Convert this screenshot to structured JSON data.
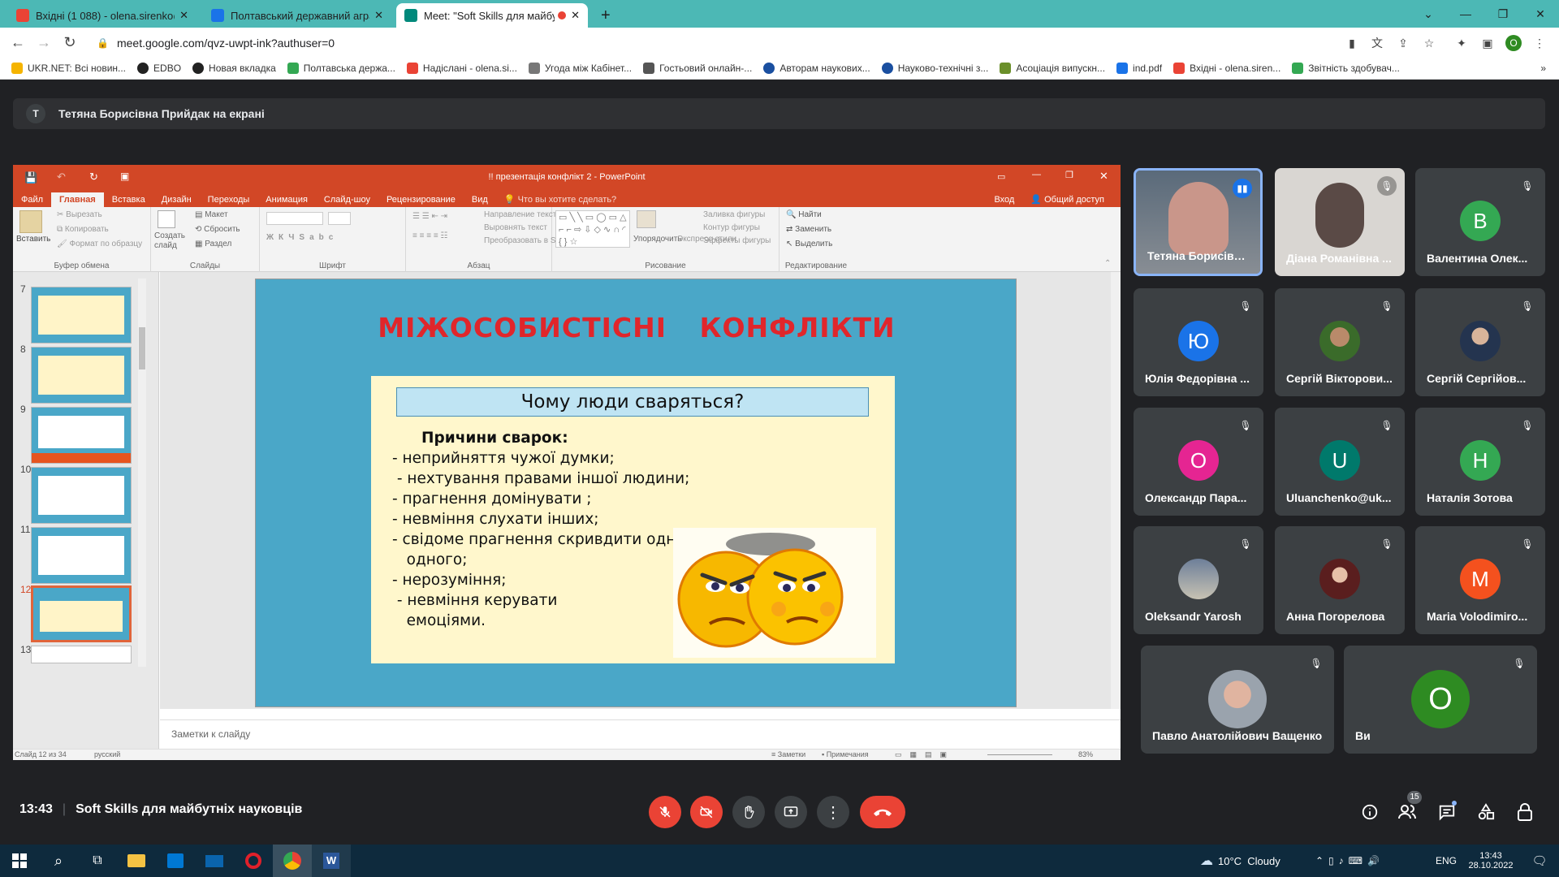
{
  "browser": {
    "tabs": [
      {
        "title": "Вхідні (1 088) - olena.sirenko@p",
        "color": "#ea4335"
      },
      {
        "title": "Полтавський державний аграр",
        "color": "#1a73e8"
      },
      {
        "title": "Meet: \"Soft Skills для майбут",
        "color": "#00897b"
      }
    ],
    "url": "meet.google.com/qvz-uwpt-ink?authuser=0",
    "profile_initial": "O",
    "bookmarks": [
      {
        "label": "UKR.NET: Всі новин...",
        "color": "#f5b400"
      },
      {
        "label": "EDBO",
        "color": "#222222"
      },
      {
        "label": "Новая вкладка",
        "color": "#222222"
      },
      {
        "label": "Полтавська держа...",
        "color": "#34a853"
      },
      {
        "label": "Надіслані - olena.si...",
        "color": "#ea4335"
      },
      {
        "label": "Угода між Кабінет...",
        "color": "#777777"
      },
      {
        "label": "Гостьовий онлайн-...",
        "color": "#555555"
      },
      {
        "label": "Авторам наукових...",
        "color": "#1a4fa0"
      },
      {
        "label": "Науково-технічні з...",
        "color": "#1a4fa0"
      },
      {
        "label": "Асоціація випускн...",
        "color": "#6a8f2a"
      },
      {
        "label": "ind.pdf",
        "color": "#1a73e8"
      },
      {
        "label": "Вхідні - olena.siren...",
        "color": "#ea4335"
      },
      {
        "label": "Звітність здобувач...",
        "color": "#34a853"
      }
    ]
  },
  "meet": {
    "presenter_initial": "Т",
    "presenter_banner": "Тетяна Борисівна Прийдак на екрані",
    "time": "13:43",
    "meeting_title": "Soft Skills для майбутніх науковців",
    "participants_count": "15",
    "participants": [
      {
        "name": "Тетяна Борисівна...",
        "type": "photo",
        "speaking": true
      },
      {
        "name": "Діана Романівна ...",
        "type": "photo"
      },
      {
        "name": "Валентина Олек...",
        "initial": "В",
        "color": "#34a853"
      },
      {
        "name": "Юлія Федорівна ...",
        "initial": "Ю",
        "color": "#1a73e8"
      },
      {
        "name": "Сергій Вікторови...",
        "type": "avatar"
      },
      {
        "name": "Сергій Сергійов...",
        "type": "avatar"
      },
      {
        "name": "Олександр Пара...",
        "initial": "О",
        "color": "#e52592"
      },
      {
        "name": "Uluanchenko@uk...",
        "initial": "U",
        "color": "#00796b"
      },
      {
        "name": "Наталія Зотова",
        "initial": "Н",
        "color": "#34a853"
      },
      {
        "name": "Oleksandr Yarosh",
        "type": "avatar"
      },
      {
        "name": "Анна Погорелова",
        "type": "avatar"
      },
      {
        "name": "Maria Volodimiro...",
        "initial": "M",
        "color": "#f4511e"
      },
      {
        "name": "Павло Анатолійович Ващенко",
        "type": "avatar"
      },
      {
        "name": "Ви",
        "initial": "O",
        "color": "#2e8b22"
      }
    ]
  },
  "ppt": {
    "window_title": "!! презентація конфлікт 2 - PowerPoint",
    "tabs": [
      "Файл",
      "Главная",
      "Вставка",
      "Дизайн",
      "Переходы",
      "Анимация",
      "Слайд-шоу",
      "Рецензирование",
      "Вид"
    ],
    "tell_me": "Что вы хотите сделать?",
    "signin": "Вход",
    "share": "Общий доступ",
    "ribbon": {
      "paste": "Вставить",
      "cut": "Вырезать",
      "copy": "Копировать",
      "format_painter": "Формат по образцу",
      "clipboard_label": "Буфер обмена",
      "new_slide": "Создать слайд",
      "layout": "Макет",
      "reset": "Сбросить",
      "section": "Раздел",
      "slides_label": "Слайды",
      "font_label": "Шрифт",
      "text_direction": "Направление текста",
      "align_text": "Выровнять текст",
      "smartart": "Преобразовать в SmartArt",
      "paragraph_label": "Абзац",
      "arrange": "Упорядочить",
      "quick_styles": "Экспресс-стили",
      "shape_fill": "Заливка фигуры",
      "shape_outline": "Контур фигуры",
      "shape_effects": "Эффекты фигуры",
      "drawing_label": "Рисование",
      "find": "Найти",
      "replace": "Заменить",
      "select": "Выделить",
      "editing_label": "Редактирование"
    },
    "thumb_numbers": [
      "7",
      "8",
      "9",
      "10",
      "11",
      "12",
      "13"
    ],
    "selected_slide": "12",
    "slide": {
      "title": "МІЖОСОБИСТІСНІ КОНФЛІКТИ",
      "question": "Чому люди сваряться?",
      "reasons_heading": "Причини   сварок:",
      "reasons": [
        "- неприйняття чужої думки;",
        " - нехтування правами іншої людини;",
        "- прагнення домінувати ;",
        "- невміння слухати інших;",
        "- свідоме прагнення скривдити одне",
        "   одного;",
        "- нерозуміння;",
        " - невміння керувати",
        "   емоціями."
      ]
    },
    "notes_placeholder": "Заметки к слайду",
    "status_slide": "Слайд 12 из 34",
    "status_lang": "русский",
    "status_notes": "Заметки",
    "status_comments": "Примечания",
    "zoom": "83%"
  },
  "taskbar": {
    "weather": "10°C  Cloudy",
    "lang": "ENG",
    "time": "13:43",
    "date": "28.10.2022"
  }
}
